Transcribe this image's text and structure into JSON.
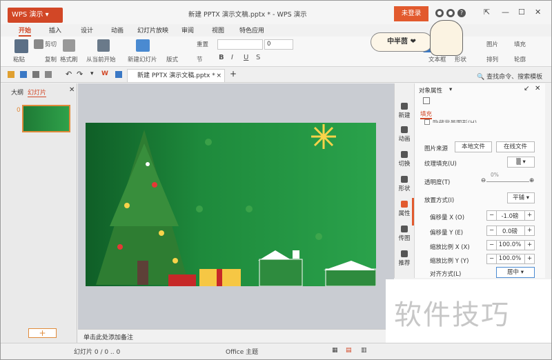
{
  "titlebar": {
    "app_button": "WPS 演示",
    "title": "新建 PPTX 演示文稿.pptx * - WPS 演示",
    "login": "未登录"
  },
  "tabs": [
    "开始",
    "插入",
    "设计",
    "动画",
    "幻灯片放映",
    "审阅",
    "视图",
    "特色应用"
  ],
  "ribbon": {
    "paste": "粘贴",
    "cut": "剪切",
    "copy": "复制",
    "format_painter": "格式刷",
    "from_current": "从当前开始",
    "new_slide": "新建幻灯片",
    "layout": "版式",
    "reset": "重置",
    "section": "节",
    "font_size": "0",
    "textbox": "文本框",
    "shape": "形状",
    "picture": "图片",
    "fill": "填充",
    "arrange": "排列",
    "outline": "轮廓"
  },
  "sticker": "中半茴 ❤",
  "qat": {
    "doc_tab": "新建 PPTX 演示文稿.pptx *",
    "search": "查找命令、搜索模板"
  },
  "left_panel": {
    "outline_tab": "大纲",
    "slides_tab": "幻灯片",
    "slide_number": "0",
    "add": "+"
  },
  "notes": "单击此处添加备注",
  "right_sidebar": [
    "新建",
    "动画",
    "切换",
    "形状",
    "属性",
    "传图",
    "推荐"
  ],
  "props": {
    "title": "对象属性",
    "fill_tab": "填充",
    "partial_text": "隐藏背景图形(H)",
    "picture_source": "图片来源",
    "local_file": "本地文件",
    "online_file": "在线文件",
    "texture_fill": "纹理填充(U)",
    "transparency": "透明度(T)",
    "transparency_value": "0%",
    "placement": "放置方式(I)",
    "placement_value": "平铺",
    "offset_x": "偏移量 X (O)",
    "offset_x_value": "-1.0磅",
    "offset_y": "偏移量 Y (E)",
    "offset_y_value": "0.0磅",
    "scale_x": "缩放比例 X (X)",
    "scale_x_value": "100.0%",
    "scale_y": "缩放比例 Y (Y)",
    "scale_y_value": "100.0%",
    "align": "对齐方式(L)",
    "align_value": "居中"
  },
  "watermark": "软件技巧",
  "status": {
    "slide_info": "幻灯片 0 / 0 .. 0",
    "theme": "Office 主题"
  },
  "colors": {
    "accent": "#d24726",
    "slide_green": "#1e8a3c"
  }
}
